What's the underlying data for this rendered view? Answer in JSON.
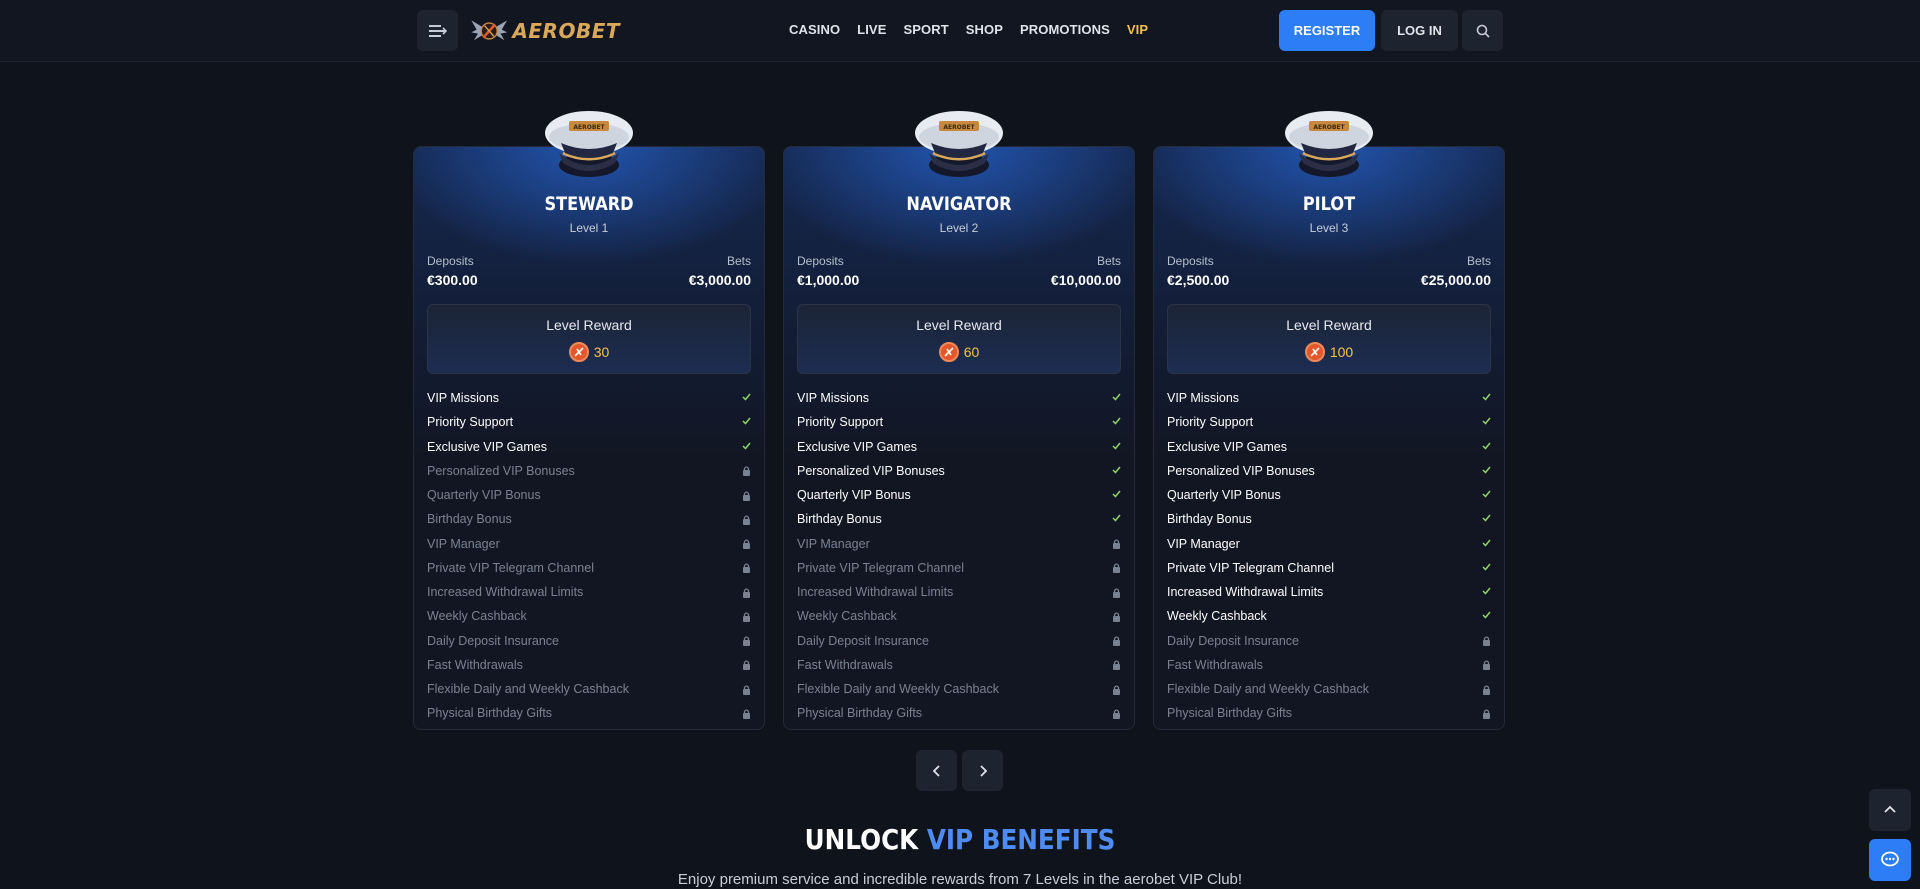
{
  "header": {
    "logo_text": "AEROBET",
    "nav": [
      "CASINO",
      "LIVE",
      "SPORT",
      "SHOP",
      "PROMOTIONS",
      "VIP"
    ],
    "active_nav": "VIP",
    "register_label": "REGISTER",
    "login_label": "LOG IN"
  },
  "labels": {
    "deposits": "Deposits",
    "bets": "Bets",
    "level_reward": "Level Reward"
  },
  "cards": [
    {
      "name": "STEWARD",
      "level": "Level 1",
      "deposits": "€300.00",
      "bets": "€3,000.00",
      "reward": "30",
      "features": [
        {
          "label": "VIP Missions",
          "enabled": true
        },
        {
          "label": "Priority Support",
          "enabled": true
        },
        {
          "label": "Exclusive VIP Games",
          "enabled": true
        },
        {
          "label": "Personalized VIP Bonuses",
          "enabled": false
        },
        {
          "label": "Quarterly VIP Bonus",
          "enabled": false
        },
        {
          "label": "Birthday Bonus",
          "enabled": false
        },
        {
          "label": "VIP Manager",
          "enabled": false
        },
        {
          "label": "Private VIP Telegram Channel",
          "enabled": false
        },
        {
          "label": "Increased Withdrawal Limits",
          "enabled": false
        },
        {
          "label": "Weekly Cashback",
          "enabled": false
        },
        {
          "label": "Daily Deposit Insurance",
          "enabled": false
        },
        {
          "label": "Fast Withdrawals",
          "enabled": false
        },
        {
          "label": "Flexible Daily and Weekly Cashback",
          "enabled": false
        },
        {
          "label": "Physical Birthday Gifts",
          "enabled": false
        }
      ]
    },
    {
      "name": "NAVIGATOR",
      "level": "Level 2",
      "deposits": "€1,000.00",
      "bets": "€10,000.00",
      "reward": "60",
      "features": [
        {
          "label": "VIP Missions",
          "enabled": true
        },
        {
          "label": "Priority Support",
          "enabled": true
        },
        {
          "label": "Exclusive VIP Games",
          "enabled": true
        },
        {
          "label": "Personalized VIP Bonuses",
          "enabled": true
        },
        {
          "label": "Quarterly VIP Bonus",
          "enabled": true
        },
        {
          "label": "Birthday Bonus",
          "enabled": true
        },
        {
          "label": "VIP Manager",
          "enabled": false
        },
        {
          "label": "Private VIP Telegram Channel",
          "enabled": false
        },
        {
          "label": "Increased Withdrawal Limits",
          "enabled": false
        },
        {
          "label": "Weekly Cashback",
          "enabled": false
        },
        {
          "label": "Daily Deposit Insurance",
          "enabled": false
        },
        {
          "label": "Fast Withdrawals",
          "enabled": false
        },
        {
          "label": "Flexible Daily and Weekly Cashback",
          "enabled": false
        },
        {
          "label": "Physical Birthday Gifts",
          "enabled": false
        }
      ]
    },
    {
      "name": "PILOT",
      "level": "Level 3",
      "deposits": "€2,500.00",
      "bets": "€25,000.00",
      "reward": "100",
      "features": [
        {
          "label": "VIP Missions",
          "enabled": true
        },
        {
          "label": "Priority Support",
          "enabled": true
        },
        {
          "label": "Exclusive VIP Games",
          "enabled": true
        },
        {
          "label": "Personalized VIP Bonuses",
          "enabled": true
        },
        {
          "label": "Quarterly VIP Bonus",
          "enabled": true
        },
        {
          "label": "Birthday Bonus",
          "enabled": true
        },
        {
          "label": "VIP Manager",
          "enabled": true
        },
        {
          "label": "Private VIP Telegram Channel",
          "enabled": true
        },
        {
          "label": "Increased Withdrawal Limits",
          "enabled": true
        },
        {
          "label": "Weekly Cashback",
          "enabled": true
        },
        {
          "label": "Daily Deposit Insurance",
          "enabled": false
        },
        {
          "label": "Fast Withdrawals",
          "enabled": false
        },
        {
          "label": "Flexible Daily and Weekly Cashback",
          "enabled": false
        },
        {
          "label": "Physical Birthday Gifts",
          "enabled": false
        }
      ]
    }
  ],
  "section": {
    "title_white": "UNLOCK",
    "title_blue": "VIP BENEFITS",
    "subtitle": "Enjoy premium service and incredible rewards from 7 Levels in the aerobet VIP Club!"
  },
  "colors": {
    "accent_blue": "#2d7df6",
    "vip_gold": "#f5c14b",
    "check_green": "#8fd36a"
  }
}
